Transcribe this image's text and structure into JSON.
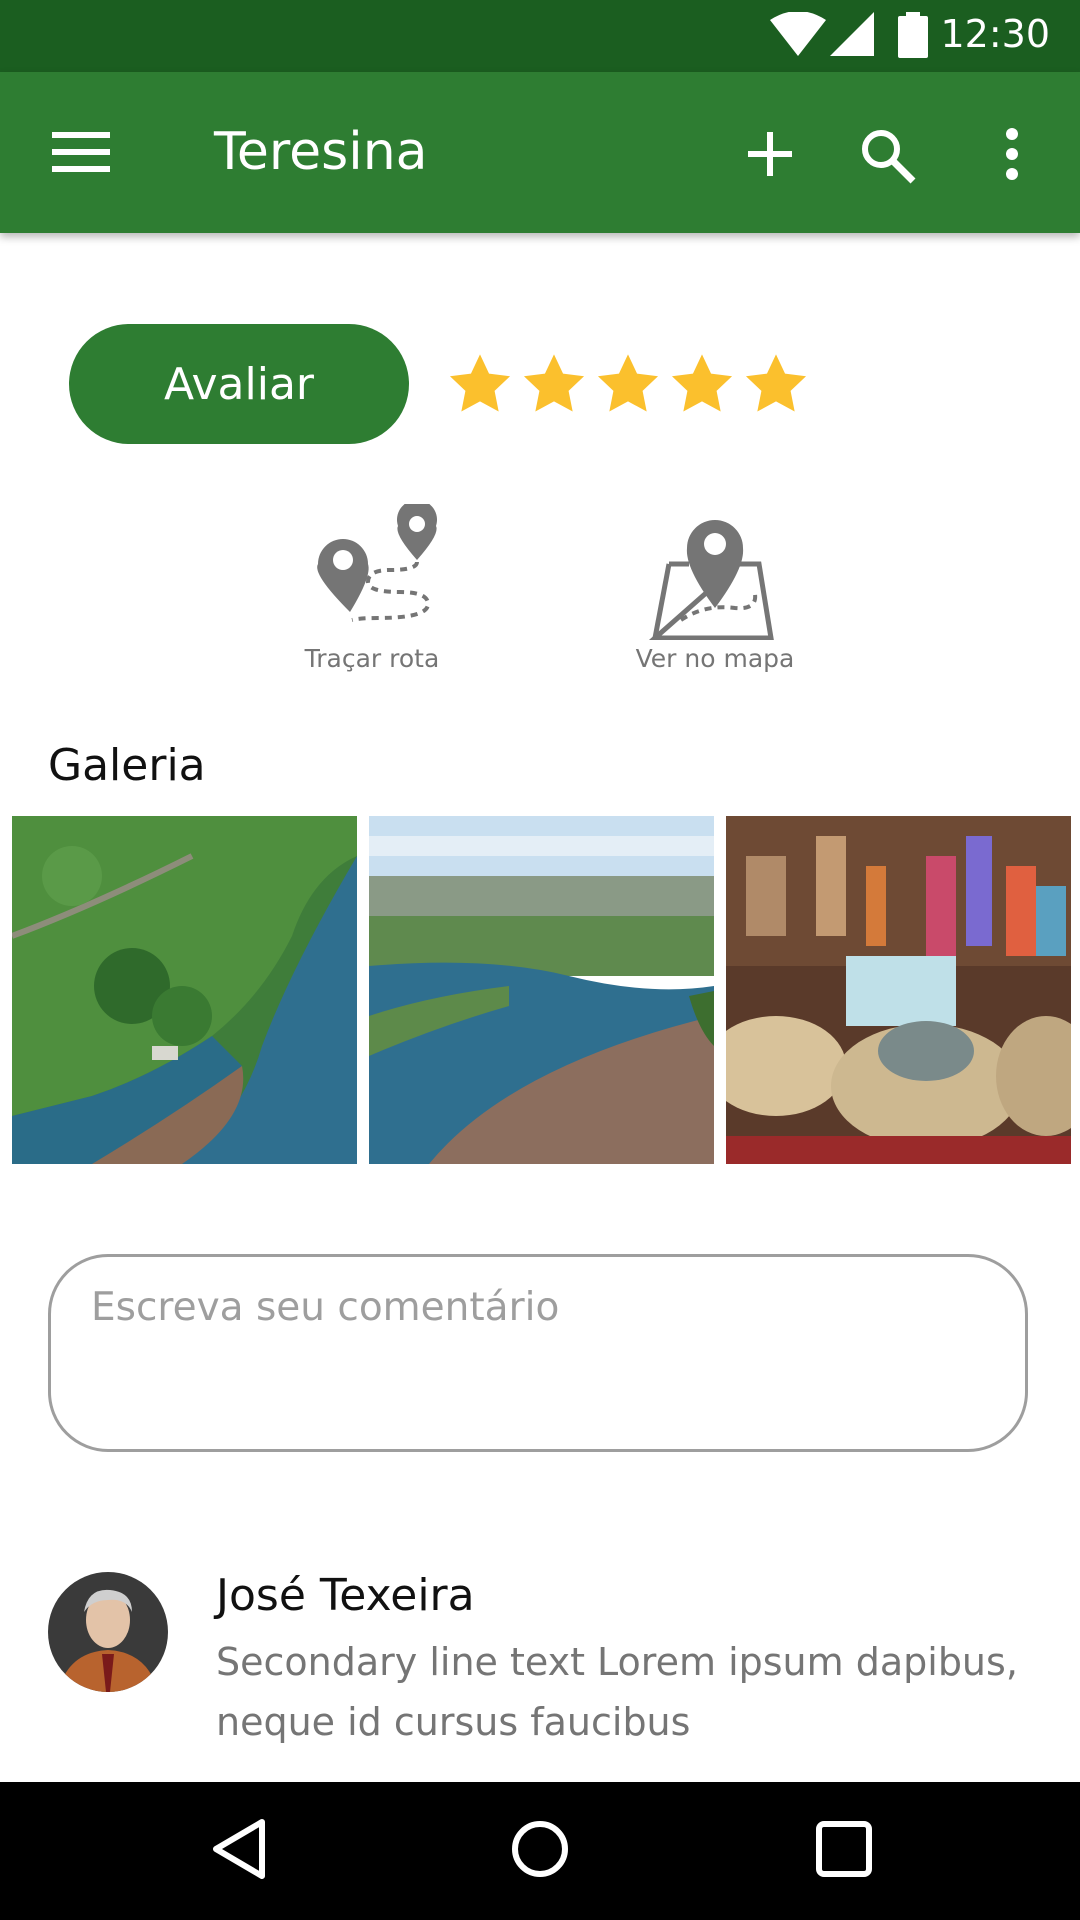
{
  "status_bar": {
    "time": "12:30",
    "icons": [
      "wifi-icon",
      "signal-icon",
      "battery-icon"
    ]
  },
  "app_bar": {
    "title": "Teresina",
    "icons": [
      "menu-icon",
      "add-icon",
      "search-icon",
      "more-vert-icon"
    ],
    "color": "#2e7d32"
  },
  "rating": {
    "button_label": "Avaliar",
    "stars_filled": 5,
    "stars_total": 5,
    "star_color": "#fbc02d"
  },
  "actions": [
    {
      "label": "Traçar rota",
      "icon": "route-icon"
    },
    {
      "label": "Ver no mapa",
      "icon": "map-pin-icon"
    }
  ],
  "gallery": {
    "title": "Galeria",
    "images": [
      "river-aerial-image",
      "river-city-image",
      "straw-hats-market-image"
    ]
  },
  "comment_input": {
    "placeholder": "Escreva seu comentário",
    "value": ""
  },
  "comments": [
    {
      "author": "José Texeira",
      "text": "Secondary line text Lorem ipsum dapibus, neque id cursus faucibus"
    }
  ],
  "nav_bar": {
    "icons": [
      "back-icon",
      "home-icon",
      "recents-icon"
    ]
  },
  "colors": {
    "status_bar": "#1b5e20",
    "primary": "#2e7d32",
    "icon_gray": "#757575"
  }
}
